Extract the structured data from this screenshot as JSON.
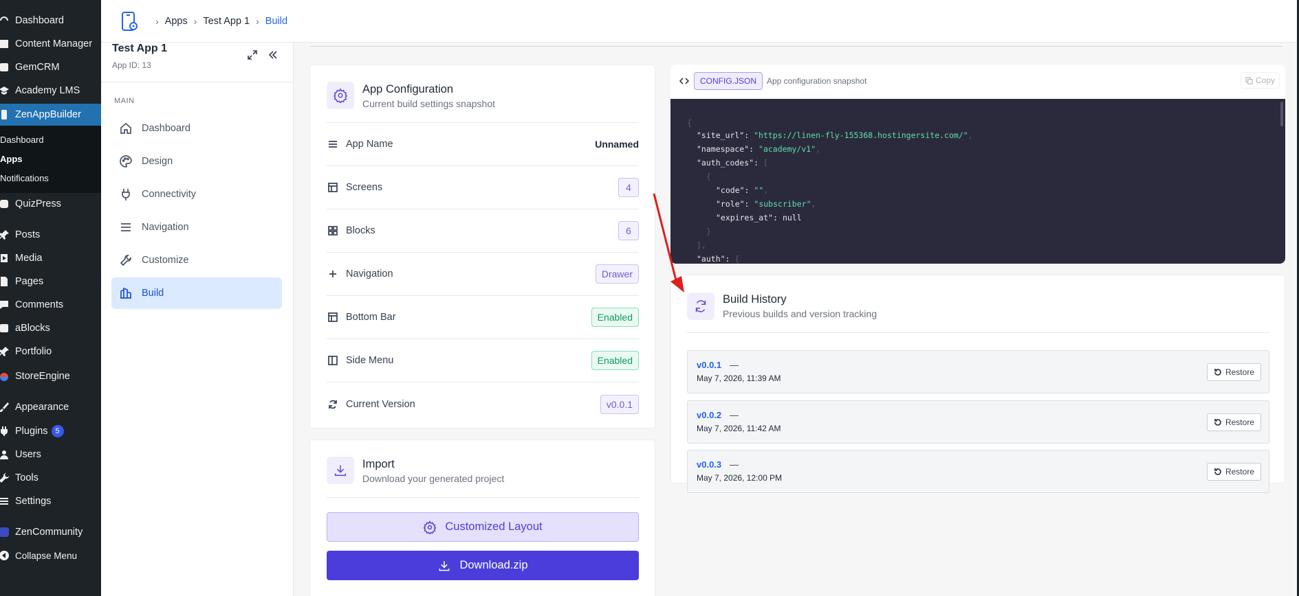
{
  "wp_menu": {
    "items": [
      {
        "label": "Dashboard",
        "icon": "dashboard-icon"
      },
      {
        "label": "Content Manager",
        "icon": "content-icon"
      },
      {
        "label": "GemCRM",
        "icon": "crm-icon"
      },
      {
        "label": "Academy LMS",
        "icon": "academy-icon"
      },
      {
        "label": "ZenAppBuilder",
        "icon": "app-icon"
      },
      {
        "label": "QuizPress",
        "icon": "quiz-icon"
      },
      {
        "label": "Posts",
        "icon": "pin-icon"
      },
      {
        "label": "Media",
        "icon": "media-icon"
      },
      {
        "label": "Pages",
        "icon": "pages-icon"
      },
      {
        "label": "Comments",
        "icon": "comments-icon"
      },
      {
        "label": "aBlocks",
        "icon": "blocks-icon"
      },
      {
        "label": "Portfolio",
        "icon": "pin-icon"
      },
      {
        "label": "StoreEngine",
        "icon": "store-icon"
      },
      {
        "label": "Appearance",
        "icon": "brush-icon"
      },
      {
        "label": "Plugins",
        "icon": "plugin-icon",
        "badge": "5"
      },
      {
        "label": "Users",
        "icon": "users-icon"
      },
      {
        "label": "Tools",
        "icon": "wrench-icon"
      },
      {
        "label": "Settings",
        "icon": "settings-icon"
      },
      {
        "label": "ZenCommunity",
        "icon": "community-icon"
      },
      {
        "label": "Collapse Menu",
        "icon": "collapse-icon"
      }
    ],
    "submenu": [
      "Dashboard",
      "Apps",
      "Notifications"
    ]
  },
  "breadcrumb": [
    "Apps",
    "Test App 1",
    "Build"
  ],
  "app": {
    "title": "Test App 1",
    "id_label": "App ID: 13"
  },
  "sidebar": {
    "section": "MAIN",
    "items": [
      {
        "label": "Dashboard"
      },
      {
        "label": "Design"
      },
      {
        "label": "Connectivity"
      },
      {
        "label": "Navigation"
      },
      {
        "label": "Customize"
      },
      {
        "label": "Build"
      }
    ]
  },
  "config_card": {
    "title": "App Configuration",
    "subtitle": "Current build settings snapshot",
    "rows": [
      {
        "label": "App Name",
        "value": "Unnamed"
      },
      {
        "label": "Screens",
        "value": "4"
      },
      {
        "label": "Blocks",
        "value": "6"
      },
      {
        "label": "Navigation",
        "value": "Drawer"
      },
      {
        "label": "Bottom Bar",
        "value": "Enabled"
      },
      {
        "label": "Side Menu",
        "value": "Enabled"
      },
      {
        "label": "Current Version",
        "value": "v0.0.1"
      }
    ]
  },
  "import_card": {
    "title": "Import",
    "subtitle": "Download your generated project",
    "layout_button": "Customized Layout",
    "download_button": "Download.zip"
  },
  "code_card": {
    "tag": "CONFIG.JSON",
    "description": "App configuration snapshot",
    "copy_label": "Copy",
    "lines": [
      {
        "key": "\"site_url\"",
        "val": "\"https://linen-fly-155368.hostingersite.com/\""
      },
      {
        "key": "\"namespace\"",
        "val": "\"academy/v1\""
      },
      {
        "key": "\"auth_codes\"",
        "val": ""
      },
      {
        "key": "\"code\"",
        "val": "\"\""
      },
      {
        "key": "\"role\"",
        "val": "\"subscriber\""
      },
      {
        "key": "\"expires_at\"",
        "val": "null"
      },
      {
        "key": "\"auth\"",
        "val": ""
      }
    ]
  },
  "history_card": {
    "title": "Build History",
    "subtitle": "Previous builds and version tracking",
    "restore_label": "Restore",
    "builds": [
      {
        "version": "v0.0.1",
        "dash": "—",
        "date": "May 7, 2026, 11:39 AM"
      },
      {
        "version": "v0.0.2",
        "dash": "—",
        "date": "May 7, 2026, 11:42 AM"
      },
      {
        "version": "v0.0.3",
        "dash": "—",
        "date": "May 7, 2026, 12:00 PM"
      }
    ]
  },
  "colors": {
    "accent": "#4a3ddb",
    "wp_active": "#2271b1",
    "link": "#2563eb",
    "annotation_arrow": "#e11d1d"
  }
}
